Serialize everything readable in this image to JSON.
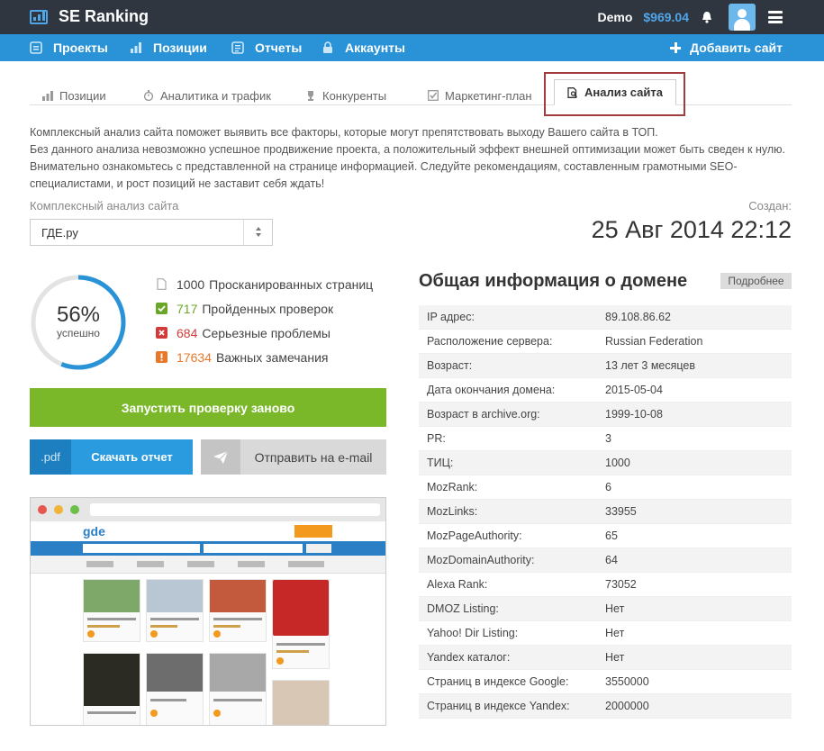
{
  "header": {
    "logo_text": "SE Ranking",
    "user": "Demo",
    "balance": "$969.04"
  },
  "nav": {
    "items": [
      {
        "label": "Проекты",
        "icon": "projects-icon"
      },
      {
        "label": "Позиции",
        "icon": "positions-icon"
      },
      {
        "label": "Отчеты",
        "icon": "reports-icon"
      },
      {
        "label": "Аккаунты",
        "icon": "lock-icon"
      }
    ],
    "add_site": "Добавить сайт"
  },
  "tabs": [
    {
      "label": "Позиции",
      "icon": "bar-chart-icon"
    },
    {
      "label": "Аналитика и трафик",
      "icon": "stopwatch-icon"
    },
    {
      "label": "Конкуренты",
      "icon": "trophy-icon"
    },
    {
      "label": "Маркетинг-план",
      "icon": "checkbox-icon"
    },
    {
      "label": "Анализ сайта",
      "icon": "document-search-icon",
      "active": true
    }
  ],
  "intro": [
    "Комплексный анализ сайта поможет выявить все факторы, которые могут препятствовать выходу Вашего сайта в ТОП.",
    "Без данного анализа невозможно успешное продвижение проекта, а положительный эффект внешней оптимизации может быть сведен к нулю.",
    "Внимательно ознакомьтесь с представленной на странице информацией. Следуйте рекомендациям, составленным грамотными SEO-",
    "специалистами, и рост позиций не заставит себя ждать!"
  ],
  "analysis": {
    "label": "Комплексный анализ сайта",
    "selected_site": "ГДЕ.ру",
    "created_label": "Создан:",
    "created_date": "25 Авг 2014 22:12"
  },
  "progress": {
    "percent_text": "56%",
    "percent_value": 56,
    "subtitle": "успешно"
  },
  "stats": [
    {
      "count": "1000",
      "label": "Просканированных страниц",
      "icon": "page-icon",
      "color": "#444444"
    },
    {
      "count": "717",
      "label": "Пройденных проверок",
      "icon": "check-icon",
      "color": "#6aa728"
    },
    {
      "count": "684",
      "label": "Серьезные проблемы",
      "icon": "error-icon",
      "color": "#d33b3b"
    },
    {
      "count": "17634",
      "label": "Важных замечания",
      "icon": "warning-icon",
      "color": "#e8782a"
    }
  ],
  "actions": {
    "rerun": "Запустить проверку заново",
    "pdf_tag": ".pdf",
    "download": "Скачать отчет",
    "email": "Отправить на e-mail"
  },
  "preview": {
    "logo": "gde"
  },
  "domain_info": {
    "title": "Общая информация о домене",
    "more": "Подробнее",
    "rows": [
      {
        "key": "IP адрес:",
        "value": "89.108.86.62"
      },
      {
        "key": "Расположение сервера:",
        "value": "Russian Federation"
      },
      {
        "key": "Возраст:",
        "value": "13 лет 3 месяцев"
      },
      {
        "key": "Дата окончания домена:",
        "value": "2015-05-04"
      },
      {
        "key": "Возраст в archive.org:",
        "value": "1999-10-08"
      },
      {
        "key": "PR:",
        "value": "3"
      },
      {
        "key": "ТИЦ:",
        "value": "1000"
      },
      {
        "key": "MozRank:",
        "value": "6"
      },
      {
        "key": "MozLinks:",
        "value": "33955"
      },
      {
        "key": "MozPageAuthority:",
        "value": "65"
      },
      {
        "key": "MozDomainAuthority:",
        "value": "64"
      },
      {
        "key": "Alexa Rank:",
        "value": "73052"
      },
      {
        "key": "DMOZ Listing:",
        "value": "Нет"
      },
      {
        "key": "Yahoo! Dir Listing:",
        "value": "Нет"
      },
      {
        "key": "Yandex каталог:",
        "value": "Нет"
      },
      {
        "key": "Страниц в индексе Google:",
        "value": "3550000"
      },
      {
        "key": "Страниц в индексе Yandex:",
        "value": "2000000"
      }
    ]
  },
  "colors": {
    "topbar": "#2f3640",
    "navbar": "#2a93d8",
    "accent": "#4fa6e8",
    "rerun": "#7ab82a",
    "download": "#2b9be0",
    "highlight": "#a33c3c"
  }
}
